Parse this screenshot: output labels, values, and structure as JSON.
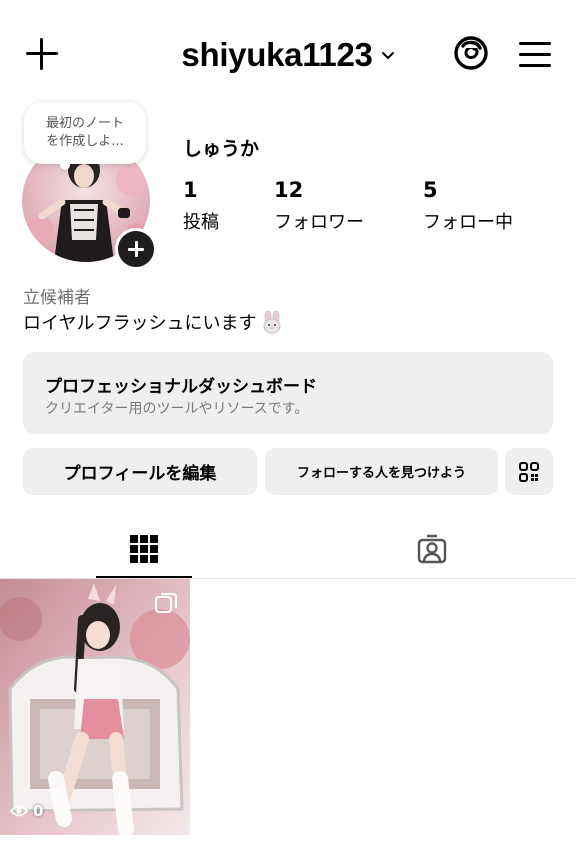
{
  "header": {
    "username": "shiyuka1123",
    "icons": [
      "plus-icon",
      "chevron-down-icon",
      "threads-icon",
      "menu-icon"
    ]
  },
  "note": {
    "line1": "最初のノート",
    "line2": "を作成しよ..."
  },
  "profile": {
    "display_name": "しゅうか",
    "stats": {
      "posts_count": "1",
      "posts_label": "投稿",
      "followers_count": "12",
      "followers_label": "フォロワー",
      "following_count": "5",
      "following_label": "フォロー中"
    },
    "category": "立候補者",
    "bio": "ロイヤルフラッシュにいます"
  },
  "dashboard": {
    "title": "プロフェッショナルダッシュボード",
    "subtitle": "クリエイター用のツールやリソースです。"
  },
  "actions": {
    "edit_profile": "プロフィールを編集",
    "find_people": "フォローする人を見つけよう"
  },
  "tabs": [
    {
      "name": "posts-grid",
      "icon": "grid-icon",
      "active": true
    },
    {
      "name": "tagged",
      "icon": "tagged-person-icon",
      "active": false
    }
  ],
  "posts": [
    {
      "views": "0",
      "multi": true
    }
  ],
  "colors": {
    "button_bg": "#efeff1",
    "text": "#000000",
    "secondary_text": "#6f6f6f"
  }
}
